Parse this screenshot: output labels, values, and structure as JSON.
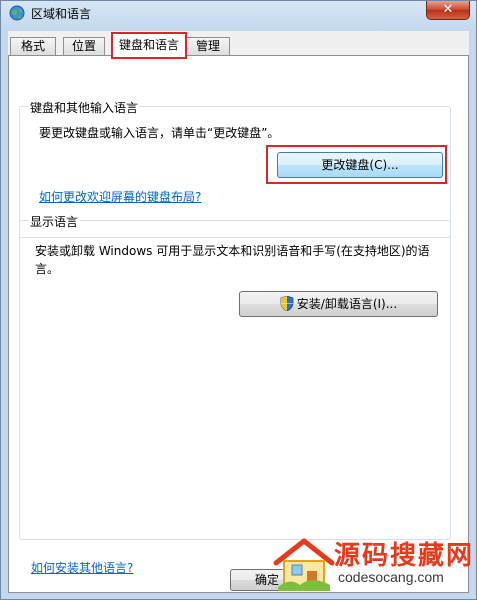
{
  "window": {
    "title": "区域和语言",
    "close_label": "✕"
  },
  "tabs": [
    {
      "label": "格式"
    },
    {
      "label": "位置"
    },
    {
      "label": "键盘和语言"
    },
    {
      "label": "管理"
    }
  ],
  "keyboard_group": {
    "title": "键盘和其他输入语言",
    "description": "要更改键盘或输入语言，请单击“更改键盘”。",
    "change_keyboard_button": "更改键盘(C)...",
    "welcome_link": "如何更改欢迎屏幕的键盘布局?"
  },
  "display_group": {
    "title": "显示语言",
    "description_line1": "安装或卸载 Windows 可用于显示文本和识别语音和手写(在支持地区)的语",
    "description_line2": "言。",
    "install_button": "安装/卸载语言(I)..."
  },
  "footer": {
    "install_link": "如何安装其他语言?",
    "ok_button": "确定"
  },
  "watermark": {
    "brand": "源码搜藏网",
    "url": "codesocang.com"
  },
  "colors": {
    "highlight_red": "#d9262b",
    "link_blue": "#0066cc"
  }
}
